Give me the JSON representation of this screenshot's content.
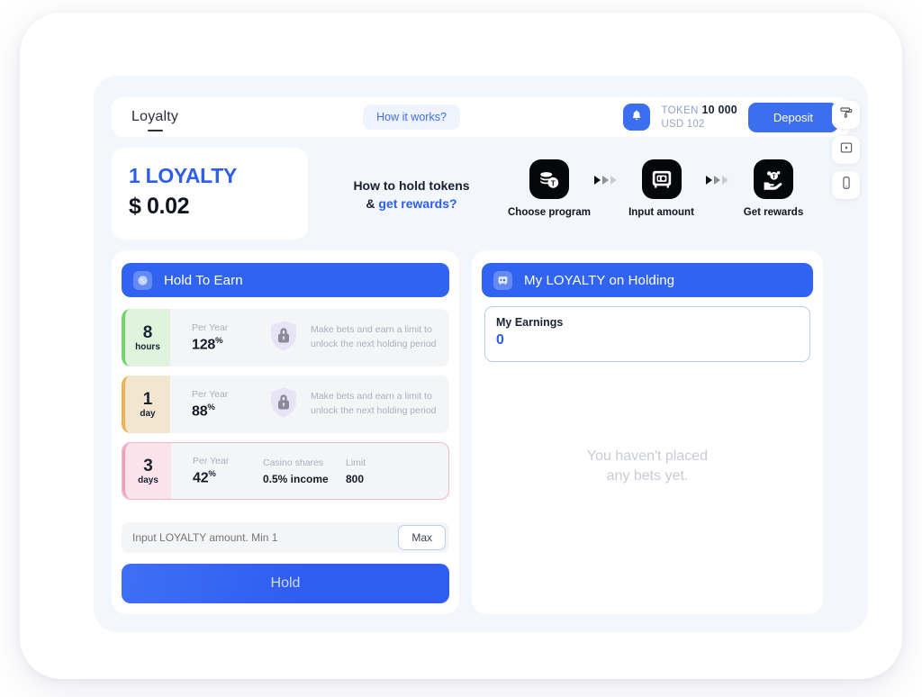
{
  "header": {
    "brand": "Loyalty",
    "how_it_works": "How it works?",
    "bell_icon": "bell-icon",
    "token_label": "TOKEN",
    "token_amount": "10 000",
    "usd_line": "USD 102",
    "deposit_label": "Deposit"
  },
  "hero": {
    "title": "1 LOYALTY",
    "price": "$ 0.02",
    "copy_line1": "How to hold tokens",
    "copy_amp": "& ",
    "copy_link": "get rewards?",
    "accent_color": "#2c5ef0"
  },
  "steps": [
    {
      "label": "Choose program",
      "icon": "coins-token-icon"
    },
    {
      "label": "Input amount",
      "icon": "safe-vault-icon"
    },
    {
      "label": "Get rewards",
      "icon": "hand-coins-icon"
    }
  ],
  "hold_to_earn": {
    "title": "Hold To Earn",
    "icon": "coin-icon",
    "programs": [
      {
        "duration": "8",
        "unit": "hours",
        "badge_color": "#dff3dd",
        "bar_color": "#72d46b",
        "selected": false,
        "per_year_label": "Per Year",
        "per_year_value": "128",
        "per_year_suffix": "%",
        "locked": true,
        "lock_icon": "shield-lock-icon",
        "description": "Make bets and earn a limit to unlock the next holding period"
      },
      {
        "duration": "1",
        "unit": "day",
        "badge_color": "#f2e6d0",
        "bar_color": "#eeb256",
        "selected": false,
        "per_year_label": "Per Year",
        "per_year_value": "88",
        "per_year_suffix": "%",
        "locked": true,
        "lock_icon": "shield-lock-icon",
        "description": "Make bets and earn a limit to unlock the next holding period"
      },
      {
        "duration": "3",
        "unit": "days",
        "badge_color": "#fae3ea",
        "bar_color": "#f0a0ba",
        "selected": true,
        "per_year_label": "Per Year",
        "per_year_value": "42",
        "per_year_suffix": "%",
        "locked": false,
        "casino_shares_label": "Casino shares",
        "casino_shares_value": "0.5% income",
        "limit_label": "Limit",
        "limit_value": "800"
      }
    ],
    "amount_placeholder": "Input LOYALTY amount. Min 1",
    "amount_value": "",
    "max_label": "Max",
    "hold_label": "Hold"
  },
  "my_holding": {
    "title": "My LOYALTY on Holding",
    "icon": "safe-vault-icon",
    "earnings_label": "My Earnings",
    "earnings_value": "0",
    "empty_line1": "You haven't placed",
    "empty_line2": "any bets yet."
  },
  "side_buttons": [
    {
      "icon": "paint-roller-icon"
    },
    {
      "icon": "video-player-icon"
    },
    {
      "icon": "mobile-phone-icon"
    }
  ]
}
